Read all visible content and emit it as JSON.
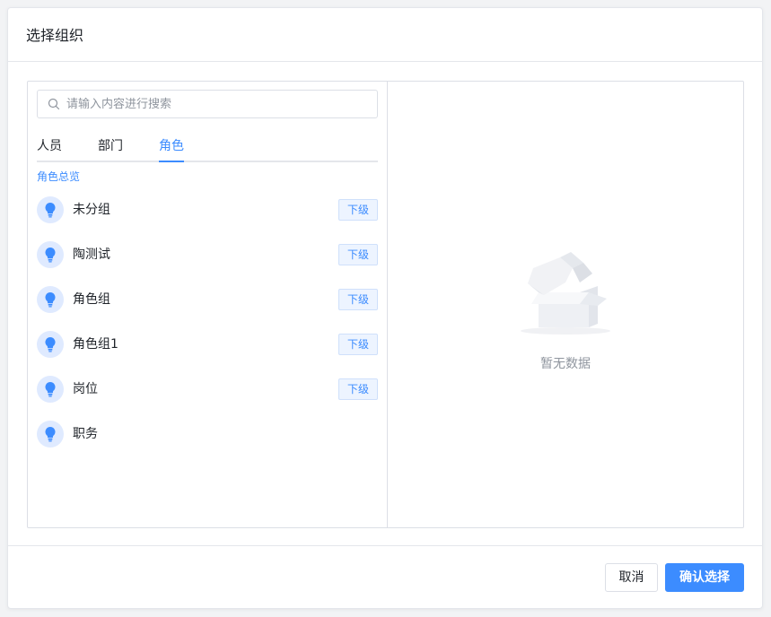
{
  "dialog": {
    "title": "选择组织"
  },
  "search": {
    "placeholder": "请输入内容进行搜索",
    "value": ""
  },
  "tabs": [
    {
      "label": "人员",
      "active": false
    },
    {
      "label": "部门",
      "active": false
    },
    {
      "label": "角色",
      "active": true
    }
  ],
  "section_label": "角色总览",
  "roles": [
    {
      "name": "未分组",
      "sub_label": "下级"
    },
    {
      "name": "陶测试",
      "sub_label": "下级"
    },
    {
      "name": "角色组",
      "sub_label": "下级"
    },
    {
      "name": "角色组1",
      "sub_label": "下级"
    },
    {
      "name": "岗位",
      "sub_label": "下级"
    },
    {
      "name": "职务",
      "sub_label": ""
    }
  ],
  "empty": {
    "text": "暂无数据",
    "icon": "empty-box-icon"
  },
  "footer": {
    "cancel_label": "取消",
    "confirm_label": "确认选择"
  },
  "colors": {
    "accent": "#3c8cff",
    "avatar_bg": "#dfeaff",
    "border": "#dcdfe6",
    "muted_text": "#8f959e"
  }
}
